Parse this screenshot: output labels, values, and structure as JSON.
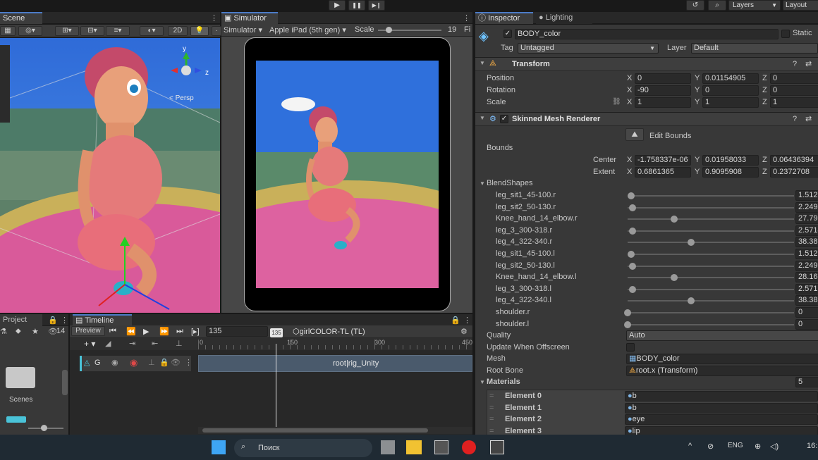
{
  "topbar": {
    "play_icon": "▶",
    "pause_icon": "❚❚",
    "step_icon": "▶❙",
    "history_icon": "↺",
    "search_icon": "⌕",
    "layers": "Layers",
    "layout": "Layout"
  },
  "scene": {
    "tab": "Scene",
    "btn_2d": "2D",
    "persp": "< Persp",
    "gizmo_y": "y",
    "gizmo_z": "z"
  },
  "simulator": {
    "tab": "Simulator",
    "mode": "Simulator ▾",
    "device": "Apple iPad (5th gen) ▾",
    "scale_label": "Scale",
    "scale_value": "19",
    "fit": "Fi"
  },
  "inspector": {
    "tab": "Inspector",
    "lighting_tab": "Lighting",
    "object_name": "BODY_color",
    "static_label": "Static",
    "tag_label": "Tag",
    "tag_value": "Untagged",
    "layer_label": "Layer",
    "layer_value": "Default",
    "transform": {
      "title": "Transform",
      "position": {
        "label": "Position",
        "x": "0",
        "y": "0.01154905",
        "z": "0"
      },
      "rotation": {
        "label": "Rotation",
        "x": "-90",
        "y": "0",
        "z": "0"
      },
      "scale": {
        "label": "Scale",
        "x": "1",
        "y": "1",
        "z": "1"
      }
    },
    "smr": {
      "title": "Skinned Mesh Renderer",
      "edit_bounds": "Edit Bounds",
      "bounds": "Bounds",
      "center": {
        "label": "Center",
        "x": "-1.758337e-06",
        "y": "0.01958033",
        "z": "0.06436394"
      },
      "extent": {
        "label": "Extent",
        "x": "0.6861365",
        "y": "0.9095908",
        "z": "0.2372708"
      },
      "blendshapes_label": "BlendShapes",
      "blendshapes": [
        {
          "name": "leg_sit1_45-100.r",
          "value": "1.5121",
          "level": 0.02
        },
        {
          "name": "leg_sit2_50-130.r",
          "value": "2.249",
          "level": 0.03
        },
        {
          "name": "Knee_hand_14_elbow.r",
          "value": "27.79",
          "level": 0.28
        },
        {
          "name": "leg_3_300-318.r",
          "value": "2.5714",
          "level": 0.03
        },
        {
          "name": "leg_4_322-340.r",
          "value": "38.38",
          "level": 0.38
        },
        {
          "name": "leg_sit1_45-100.l",
          "value": "1.5121",
          "level": 0.02
        },
        {
          "name": "leg_sit2_50-130.l",
          "value": "2.249",
          "level": 0.03
        },
        {
          "name": "Knee_hand_14_elbow.l",
          "value": "28.16",
          "level": 0.28
        },
        {
          "name": "leg_3_300-318.l",
          "value": "2.5715",
          "level": 0.03
        },
        {
          "name": "leg_4_322-340.l",
          "value": "38.38",
          "level": 0.38
        },
        {
          "name": "shoulder.r",
          "value": "0",
          "level": 0
        },
        {
          "name": "shoulder.l",
          "value": "0",
          "level": 0
        }
      ],
      "quality_label": "Quality",
      "quality_value": "Auto",
      "update_offscreen": "Update When Offscreen",
      "mesh_label": "Mesh",
      "mesh_value": "BODY_color",
      "root_bone_label": "Root Bone",
      "root_bone_value": "root.x (Transform)",
      "materials_label": "Materials",
      "materials_count": "5",
      "materials": [
        {
          "label": "Element 0",
          "value": "b"
        },
        {
          "label": "Element 1",
          "value": "b"
        },
        {
          "label": "Element 2",
          "value": "eye"
        },
        {
          "label": "Element 3",
          "value": "lip"
        }
      ]
    }
  },
  "project": {
    "tab": "Project",
    "count": "14",
    "folder": "Scenes"
  },
  "timeline": {
    "tab": "Timeline",
    "preview": "Preview",
    "frame": "135",
    "asset": "girlCOLOR-TL (TL)",
    "playhead": "135",
    "ticks": [
      "0",
      "150",
      "300",
      "450"
    ],
    "track": "G",
    "clip": "root|rig_Unity"
  },
  "taskbar": {
    "search": "Поиск",
    "lang": "ENG",
    "time": "16:"
  }
}
